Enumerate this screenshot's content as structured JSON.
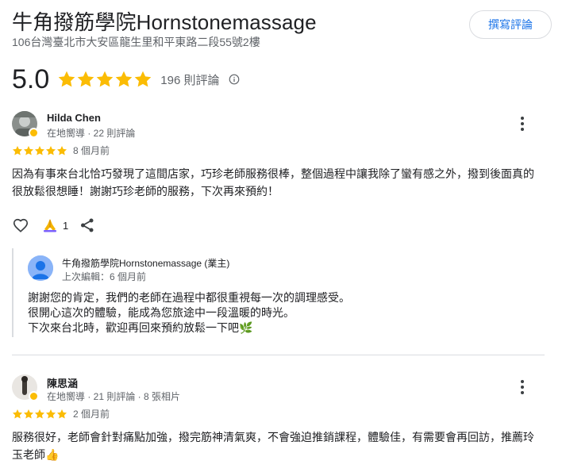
{
  "place": {
    "title": "牛角撥筋學院Hornstonemassage",
    "address": "106台灣臺北市大安區龍生里和平東路二段55號2樓",
    "write_review_label": "撰寫評論",
    "rating": "5.0",
    "review_count": "196 則評論",
    "star_color": "#fbbc04",
    "accent_color": "#1a73e8"
  },
  "reviews": [
    {
      "name": "Hilda Chen",
      "meta": "在地嚮導 · 22 則評論",
      "date": "8 個月前",
      "rating": 5,
      "text": "因為有事來台北恰巧發現了這間店家，巧珍老師服務很棒，整個過程中讓我除了蠻有感之外，撥到後面真的很放鬆很想睡！謝謝巧珍老師的服務，下次再來預約！",
      "likes": "1",
      "owner_reply": {
        "name": "牛角撥筋學院Hornstonemassage (業主)",
        "meta": "上次編輯：6 個月前",
        "line1": "謝謝您的肯定，我們的老師在過程中都很重視每一次的調理感受。",
        "line2": "很開心這次的體驗，能成為您旅途中一段溫暖的時光。",
        "line3": "下次來台北時，歡迎再回來預約放鬆一下吧🌿"
      }
    },
    {
      "name": "陳思涵",
      "meta": "在地嚮導 · 21 則評論 · 8 張相片",
      "date": "2 個月前",
      "rating": 5,
      "text": "服務很好，老師會針對痛點加強，撥完筋神清氣爽，不會強迫推銷課程，體驗佳，有需要會再回訪，推薦玲玉老師👍"
    }
  ]
}
